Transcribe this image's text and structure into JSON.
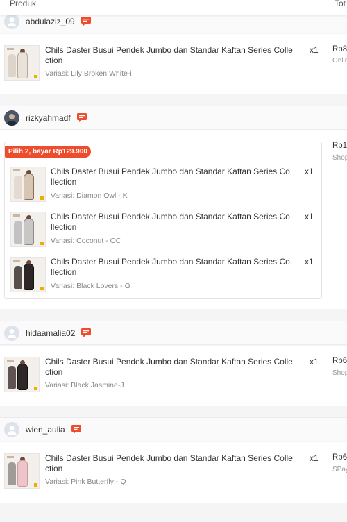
{
  "header": {
    "col_product": "Produk",
    "col_total": "Tot"
  },
  "orders": [
    {
      "username": "abdulaziz_09",
      "total": "Rp8",
      "payment": "Onlin",
      "items": [
        {
          "name": "Chils Daster Busui Pendek Jumbo dan Standar Kaftan Series Colle ction",
          "variant": "Variasi: Lily Broken White-i",
          "qty": "x1"
        }
      ]
    },
    {
      "username": "rizkyahmadf",
      "total": "Rp1",
      "payment": "Shop",
      "promo": "Pilih 2, bayar Rp129.900",
      "items": [
        {
          "name": "Chils Daster Busui Pendek Jumbo dan Standar Kaftan Series Co llection",
          "variant": "Variasi: Diamon Owl - K",
          "qty": "x1"
        },
        {
          "name": "Chils Daster Busui Pendek Jumbo dan Standar Kaftan Series Co llection",
          "variant": "Variasi: Coconut - OC",
          "qty": "x1"
        },
        {
          "name": "Chils Daster Busui Pendek Jumbo dan Standar Kaftan Series Co llection",
          "variant": "Variasi: Black Lovers - G",
          "qty": "x1"
        }
      ]
    },
    {
      "username": "hidaamalia02",
      "total": "Rp6",
      "payment": "Shop",
      "items": [
        {
          "name": "Chils Daster Busui Pendek Jumbo dan Standar Kaftan Series Colle ction",
          "variant": "Variasi: Black Jasmine-J",
          "qty": "x1"
        }
      ]
    },
    {
      "username": "wien_aulia",
      "total": "Rp6",
      "payment": "SPay",
      "items": [
        {
          "name": "Chils Daster Busui Pendek Jumbo dan Standar Kaftan Series Colle ction",
          "variant": "Variasi: Pink Butterfly - Q",
          "qty": "x1"
        }
      ]
    }
  ],
  "icons": {
    "chat": "chat-icon",
    "avatar_default": "user-icon"
  },
  "colors": {
    "accent": "#ee4d2d"
  }
}
